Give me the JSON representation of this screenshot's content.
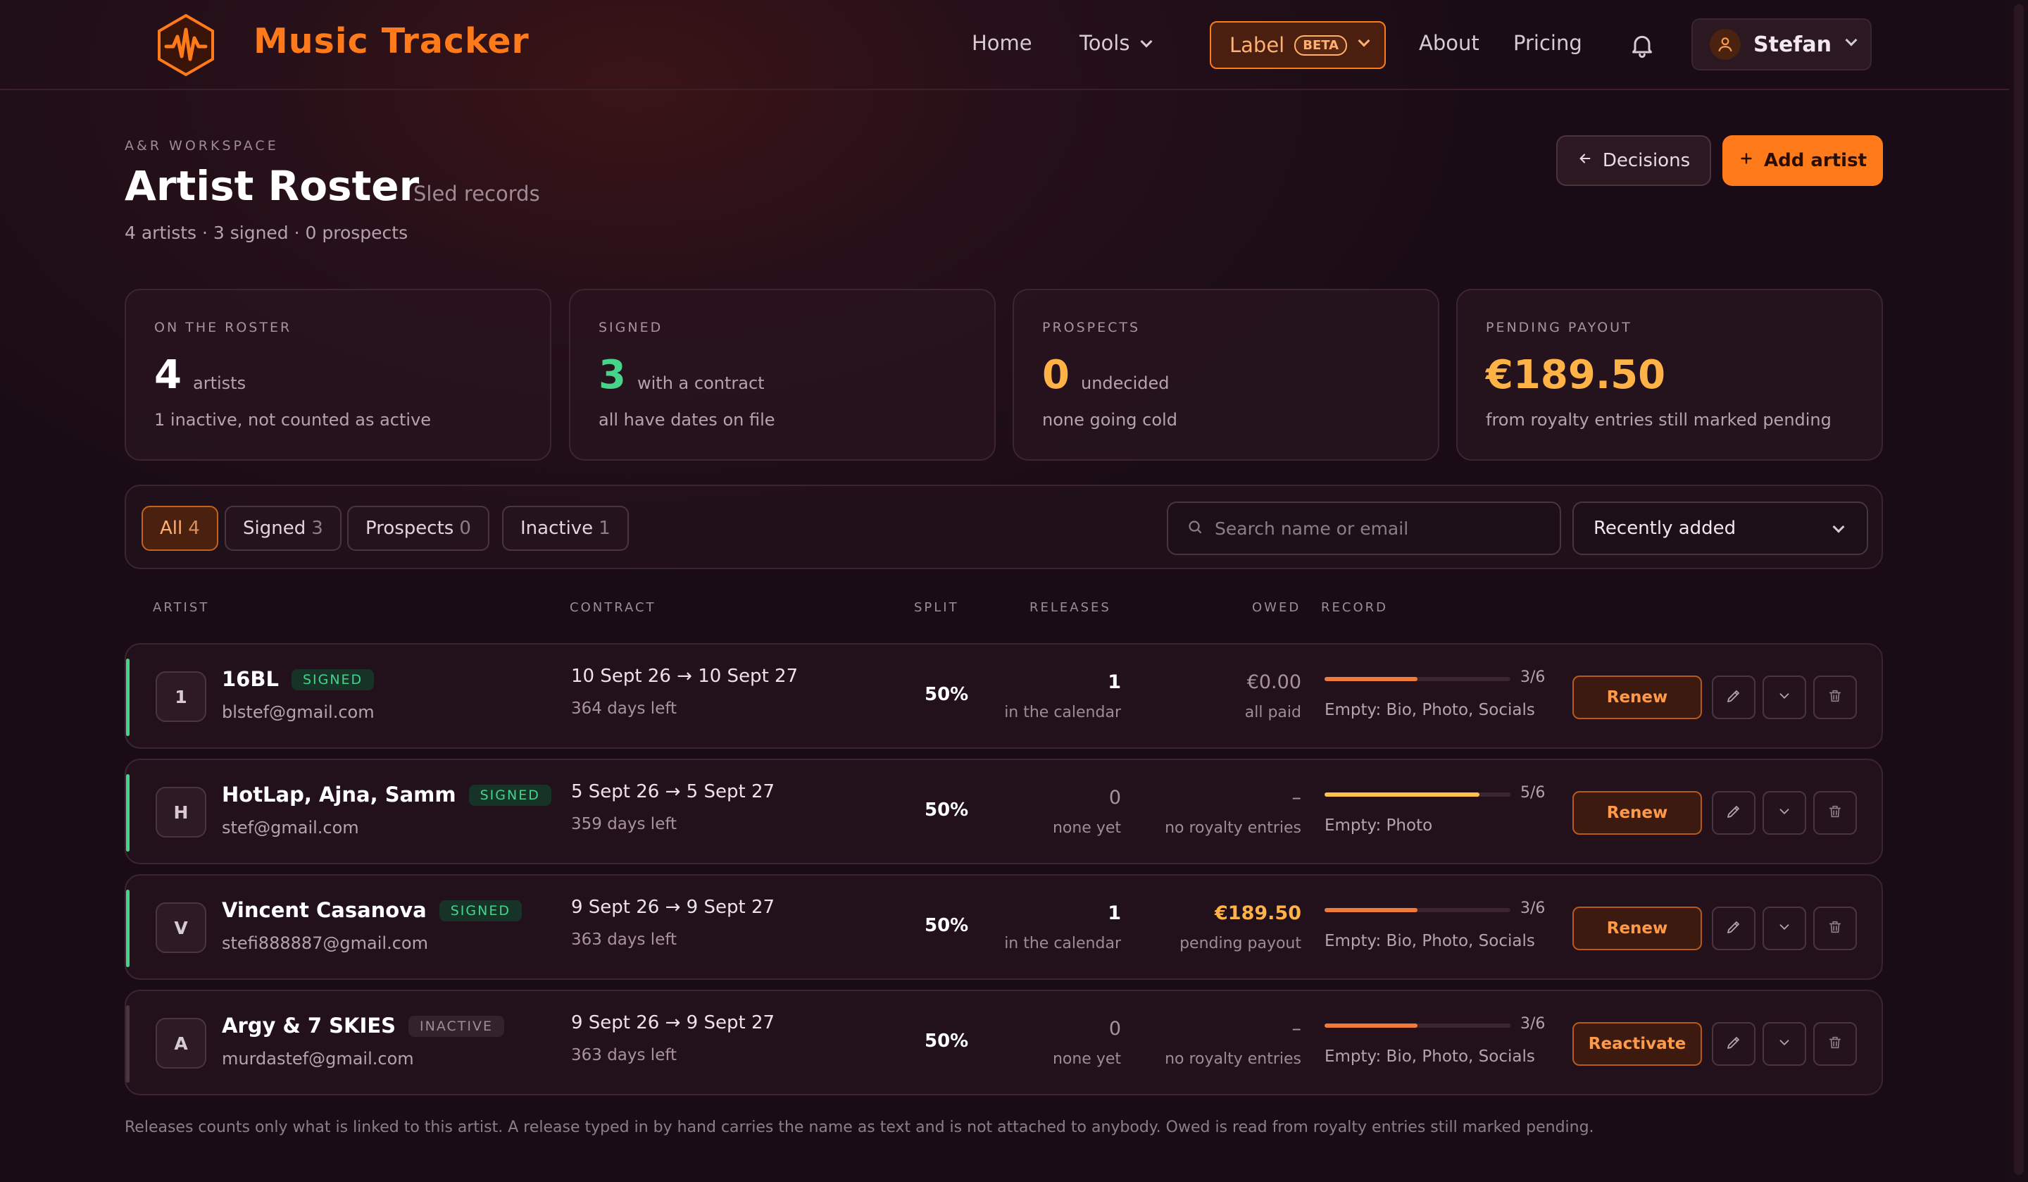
{
  "brand": {
    "name": "Music Tracker"
  },
  "nav": {
    "home": "Home",
    "tools": "Tools",
    "label": "Label",
    "label_badge": "BETA",
    "about": "About",
    "pricing": "Pricing",
    "user": "Stefan"
  },
  "page": {
    "eyebrow": "A&R WORKSPACE",
    "title": "Artist Roster",
    "subtitle": "Sled records",
    "stats": "4 artists · 3 signed · 0 prospects",
    "decisions_label": "Decisions",
    "add_label": "Add artist"
  },
  "cards": [
    {
      "label": "ON THE ROSTER",
      "value": "4",
      "unit": "artists",
      "note": "1 inactive, not counted as active",
      "color": "#ffffff"
    },
    {
      "label": "SIGNED",
      "value": "3",
      "unit": "with a contract",
      "note": "all have dates on file",
      "color": "#46d38a"
    },
    {
      "label": "PROSPECTS",
      "value": "0",
      "unit": "undecided",
      "note": "none going cold",
      "color": "#ffb347"
    },
    {
      "label": "PENDING PAYOUT",
      "value": "€189.50",
      "unit": "",
      "note": "from royalty entries still marked pending",
      "color": "#ffb347"
    }
  ],
  "filters": [
    {
      "label": "All",
      "count": "4"
    },
    {
      "label": "Signed",
      "count": "3"
    },
    {
      "label": "Prospects",
      "count": "0"
    },
    {
      "label": "Inactive",
      "count": "1"
    }
  ],
  "search": {
    "placeholder": "Search name or email"
  },
  "sort": {
    "value": "Recently added"
  },
  "columns": {
    "artist": "ARTIST",
    "contract": "CONTRACT",
    "split": "SPLIT",
    "releases": "RELEASES",
    "owed": "OWED",
    "record": "RECORD"
  },
  "rows": [
    {
      "initial": "1",
      "name": "16BL",
      "status": "SIGNED",
      "email": "blstef@gmail.com",
      "contract": "10 Sept 26 → 10 Sept 27",
      "days_left": "364 days left",
      "split": "50%",
      "releases": "1",
      "releases_note": "in the calendar",
      "owed": "€0.00",
      "owed_note": "all paid",
      "record_progress": "3/6",
      "record_fraction": 0.5,
      "empty": "Empty: Bio, Photo, Socials",
      "action": "Renew"
    },
    {
      "initial": "H",
      "name": "HotLap, Ajna, Samm",
      "status": "SIGNED",
      "email": "stef@gmail.com",
      "contract": "5 Sept 26 → 5 Sept 27",
      "days_left": "359 days left",
      "split": "50%",
      "releases": "0",
      "releases_note": "none yet",
      "owed": "–",
      "owed_note": "no royalty entries",
      "record_progress": "5/6",
      "record_fraction": 0.833,
      "empty": "Empty: Photo",
      "action": "Renew"
    },
    {
      "initial": "V",
      "name": "Vincent Casanova",
      "status": "SIGNED",
      "email": "stefi888887@gmail.com",
      "contract": "9 Sept 26 → 9 Sept 27",
      "days_left": "363 days left",
      "split": "50%",
      "releases": "1",
      "releases_note": "in the calendar",
      "owed": "€189.50",
      "owed_note": "pending payout",
      "record_progress": "3/6",
      "record_fraction": 0.5,
      "empty": "Empty: Bio, Photo, Socials",
      "action": "Renew"
    },
    {
      "initial": "A",
      "name": "Argy & 7 SKIES",
      "status": "INACTIVE",
      "email": "murdastef@gmail.com",
      "contract": "9 Sept 26 → 9 Sept 27",
      "days_left": "363 days left",
      "split": "50%",
      "releases": "0",
      "releases_note": "none yet",
      "owed": "–",
      "owed_note": "no royalty entries",
      "record_progress": "3/6",
      "record_fraction": 0.5,
      "empty": "Empty: Bio, Photo, Socials",
      "action": "Reactivate"
    }
  ],
  "footnote": "Releases counts only what is linked to this artist. A release typed in by hand carries the name as text and is not attached to anybody. Owed is read from royalty entries still marked pending.",
  "colors": {
    "accent": "#ff7a1a",
    "signed": "#46d38a",
    "pending": "#ffb347"
  },
  "icons": [
    "logo-waveform-icon",
    "chevron-down-icon",
    "bell-icon",
    "user-icon",
    "arrow-left-icon",
    "plus-icon",
    "search-icon",
    "edit-icon",
    "trash-icon"
  ]
}
